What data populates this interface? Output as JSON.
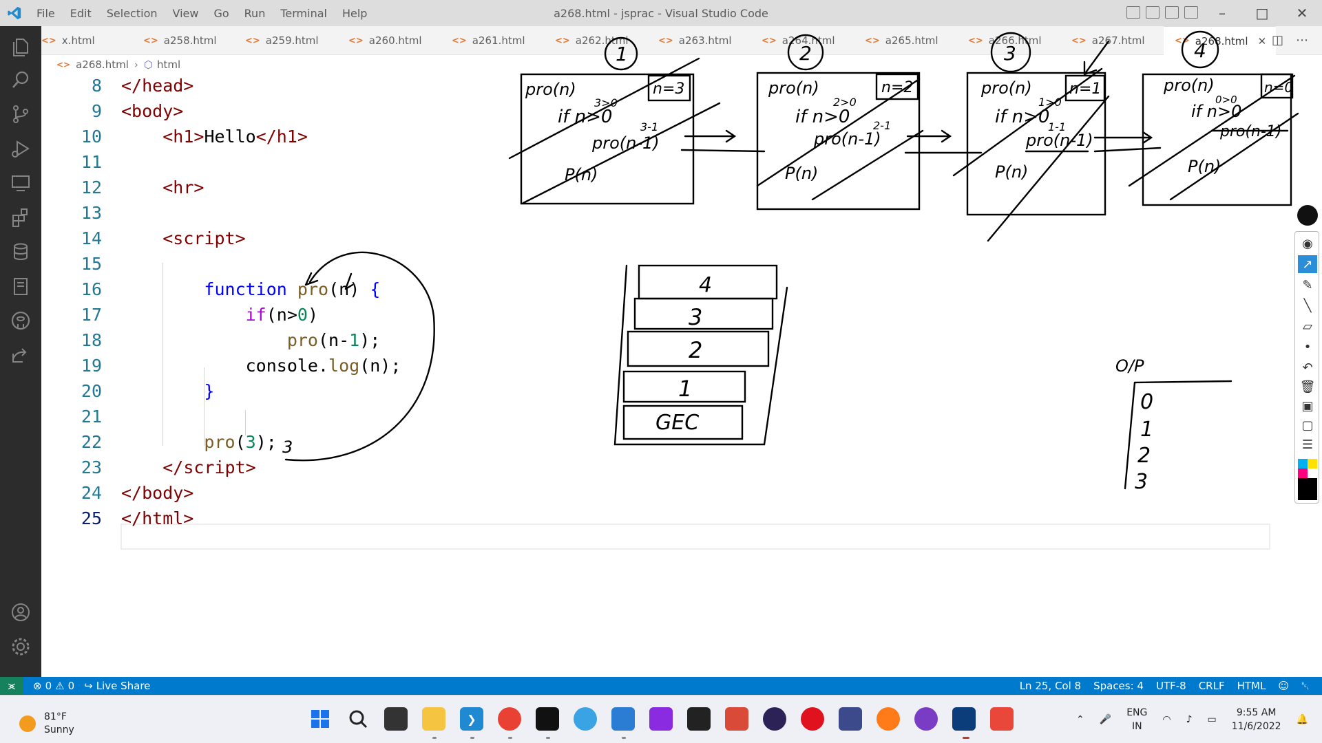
{
  "titlebar": {
    "menu": [
      "File",
      "Edit",
      "Selection",
      "View",
      "Go",
      "Run",
      "Terminal",
      "Help"
    ],
    "title": "a268.html - jsprac - Visual Studio Code"
  },
  "tabs": [
    {
      "label": "x.html",
      "active": false
    },
    {
      "label": "a258.html",
      "active": false
    },
    {
      "label": "a259.html",
      "active": false
    },
    {
      "label": "a260.html",
      "active": false
    },
    {
      "label": "a261.html",
      "active": false
    },
    {
      "label": "a262.html",
      "active": false
    },
    {
      "label": "a263.html",
      "active": false
    },
    {
      "label": "a264.html",
      "active": false
    },
    {
      "label": "a265.html",
      "active": false
    },
    {
      "label": "a266.html",
      "active": false
    },
    {
      "label": "a267.html",
      "active": false
    },
    {
      "label": "a268.html",
      "active": true
    }
  ],
  "breadcrumb": {
    "file": "a268.html",
    "node": "html"
  },
  "editor": {
    "line_numbers": [
      "8",
      "9",
      "10",
      "11",
      "12",
      "13",
      "14",
      "15",
      "16",
      "17",
      "18",
      "19",
      "20",
      "21",
      "22",
      "23",
      "24",
      "25"
    ],
    "current_line": "25"
  },
  "ink": {
    "frame_numbers": [
      "1",
      "2",
      "3",
      "4"
    ],
    "frame_heading": [
      "pro(n)",
      "pro(n)",
      "pro(n)",
      "pro(n)"
    ],
    "frame_n": [
      "n=3",
      "n=2",
      "n=1",
      "n=0"
    ],
    "frame_if": [
      "if n>0",
      "if n>0",
      "if n>0",
      "if n>0"
    ],
    "frame_cmp": [
      "3>0",
      "2>0",
      "1>0",
      "0>0"
    ],
    "frame_call": [
      "pro(n-1)",
      "pro(n-1)",
      "pro(n-1)",
      "pro(n-1)"
    ],
    "frame_sub": [
      "3-1",
      "2-1",
      "1-1",
      ""
    ],
    "frame_print": [
      "P(n)",
      "P(n)",
      "P(n)",
      "P(n)"
    ],
    "stack_items": [
      "4",
      "3",
      "2",
      "1",
      "GEC"
    ],
    "output_label": "O/P",
    "output_values": [
      "0",
      "1",
      "2",
      "3"
    ],
    "arg_note": "3"
  },
  "statusbar": {
    "problems_errors": "0",
    "problems_warnings": "0",
    "live_share": "Live Share",
    "position": "Ln 25, Col 8",
    "spaces": "Spaces: 4",
    "encoding": "UTF-8",
    "eol": "CRLF",
    "language": "HTML"
  },
  "taskbar": {
    "weather_temp": "81°F",
    "weather_desc": "Sunny",
    "lang_top": "ENG",
    "lang_bottom": "IN",
    "time": "9:55 AM",
    "date": "11/6/2022"
  },
  "colors": {
    "statusbar": "#007acc",
    "activity": "#2c2c2c",
    "tag": "#800000",
    "keyword": "#0000ff"
  }
}
